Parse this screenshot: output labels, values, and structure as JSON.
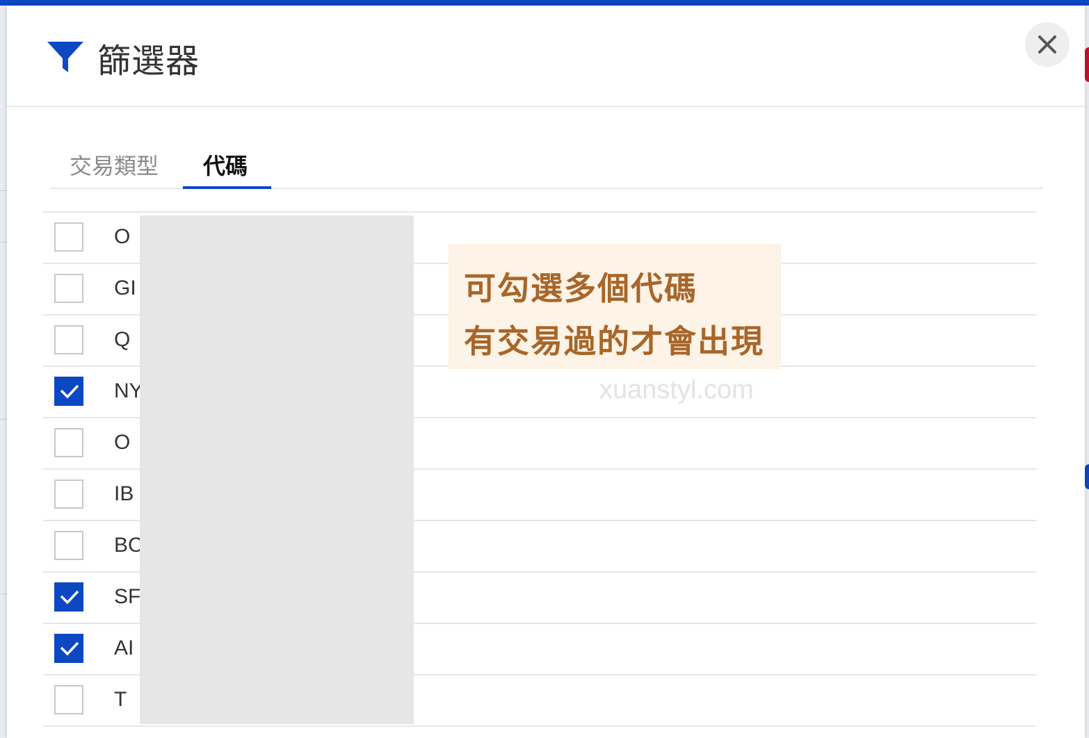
{
  "dialog": {
    "title": "篩選器",
    "tabs": [
      {
        "label": "交易類型",
        "active": false
      },
      {
        "label": "代碼",
        "active": true
      }
    ],
    "items": [
      {
        "code": "O",
        "checked": false
      },
      {
        "code": "GI",
        "checked": false
      },
      {
        "code": "Q",
        "checked": false
      },
      {
        "code": "NY",
        "checked": true
      },
      {
        "code": "O",
        "checked": false
      },
      {
        "code": "IB",
        "checked": false
      },
      {
        "code": "BC",
        "checked": false
      },
      {
        "code": "SF",
        "checked": true
      },
      {
        "code": "AI",
        "checked": true
      },
      {
        "code": "T",
        "checked": false
      }
    ]
  },
  "annotation": {
    "line1": "可勾選多個代碼",
    "line2": "有交易過的才會出現",
    "watermark": "xuanstyl.com"
  },
  "colors": {
    "accent": "#0d47c2",
    "note_bg": "#fdf3e6",
    "note_text": "#a8662a"
  }
}
